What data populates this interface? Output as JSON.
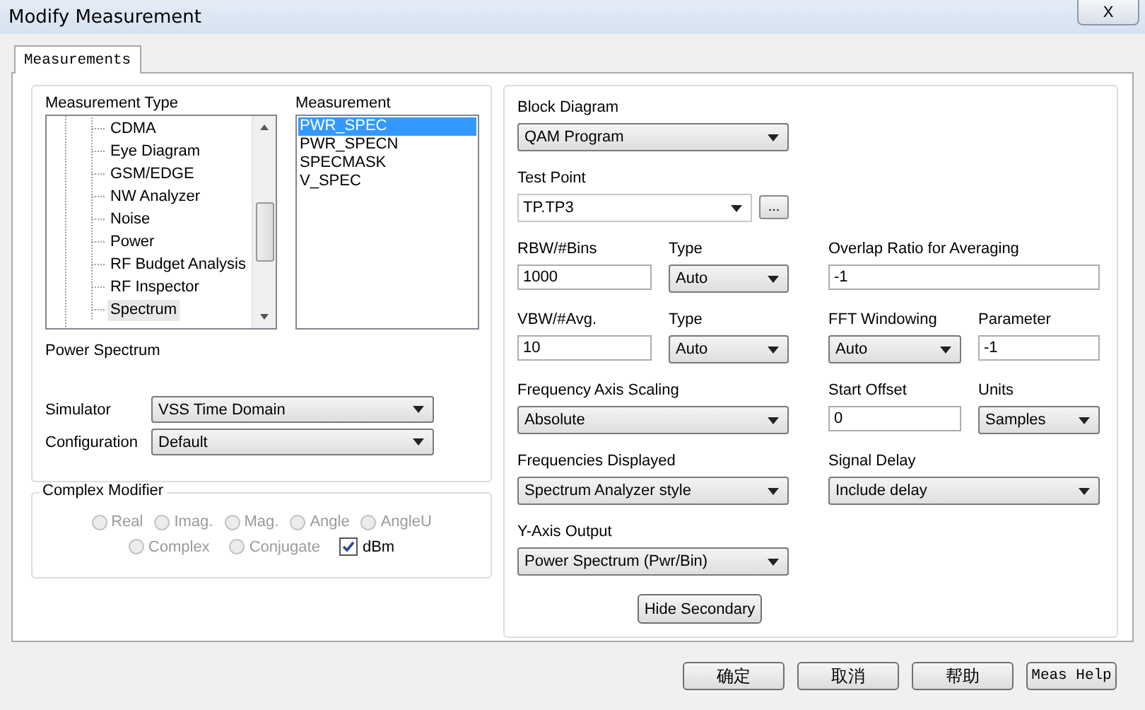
{
  "window": {
    "title": "Modify Measurement",
    "close_label": "X"
  },
  "tabs": [
    {
      "label": "Measurements",
      "selected": true
    }
  ],
  "measurement_type": {
    "label": "Measurement Type",
    "items": [
      {
        "label": "CDMA",
        "selected": false
      },
      {
        "label": "Eye Diagram",
        "selected": false
      },
      {
        "label": "GSM/EDGE",
        "selected": false
      },
      {
        "label": "NW Analyzer",
        "selected": false
      },
      {
        "label": "Noise",
        "selected": false
      },
      {
        "label": "Power",
        "selected": false
      },
      {
        "label": "RF Budget Analysis",
        "selected": false
      },
      {
        "label": "RF Inspector",
        "selected": false
      },
      {
        "label": "Spectrum",
        "selected": true
      }
    ]
  },
  "measurement": {
    "label": "Measurement",
    "items": [
      {
        "label": "PWR_SPEC",
        "selected": true
      },
      {
        "label": "PWR_SPECN",
        "selected": false
      },
      {
        "label": "SPECMASK",
        "selected": false
      },
      {
        "label": "V_SPEC",
        "selected": false
      }
    ]
  },
  "description": "Power Spectrum",
  "simulator": {
    "label": "Simulator",
    "value": "VSS Time Domain"
  },
  "configuration": {
    "label": "Configuration",
    "value": "Default"
  },
  "complex_modifier": {
    "title": "Complex Modifier",
    "options": [
      {
        "kind": "radio",
        "label": "Real",
        "selected": false,
        "disabled": true
      },
      {
        "kind": "radio",
        "label": "Imag.",
        "selected": false,
        "disabled": true
      },
      {
        "kind": "radio",
        "label": "Mag.",
        "selected": false,
        "disabled": true
      },
      {
        "kind": "radio",
        "label": "Angle",
        "selected": false,
        "disabled": true
      },
      {
        "kind": "radio",
        "label": "AngleU",
        "selected": false,
        "disabled": true
      },
      {
        "kind": "radio",
        "label": "Complex",
        "selected": false,
        "disabled": true
      },
      {
        "kind": "radio",
        "label": "Conjugate",
        "selected": false,
        "disabled": true
      },
      {
        "kind": "checkbox",
        "label": "dBm",
        "checked": true,
        "disabled": false
      }
    ]
  },
  "settings": [
    {
      "kind": "dropdown",
      "label": "Block Diagram",
      "value": "QAM Program"
    },
    {
      "kind": "combo",
      "label": "Test Point",
      "value": "TP.TP3",
      "browse": "..."
    },
    {
      "kind": "text",
      "label": "RBW/#Bins",
      "value": "1000"
    },
    {
      "kind": "dropdown",
      "label": "Type",
      "value": "Auto"
    },
    {
      "kind": "text",
      "label": "Overlap Ratio for Averaging",
      "value": "-1"
    },
    {
      "kind": "text",
      "label": "VBW/#Avg.",
      "value": "10"
    },
    {
      "kind": "dropdown",
      "label": "Type",
      "value": "Auto"
    },
    {
      "kind": "dropdown",
      "label": "FFT Windowing",
      "value": "Auto"
    },
    {
      "kind": "text",
      "label": "Parameter",
      "value": "-1"
    },
    {
      "kind": "dropdown",
      "label": "Frequency Axis Scaling",
      "value": "Absolute"
    },
    {
      "kind": "text",
      "label": "Start Offset",
      "value": "0"
    },
    {
      "kind": "dropdown",
      "label": "Units",
      "value": "Samples"
    },
    {
      "kind": "dropdown",
      "label": "Frequencies Displayed",
      "value": "Spectrum Analyzer style"
    },
    {
      "kind": "dropdown",
      "label": "Signal Delay",
      "value": "Include delay"
    },
    {
      "kind": "dropdown",
      "label": "Y-Axis Output",
      "value": "Power Spectrum (Pwr/Bin)"
    }
  ],
  "hide_secondary": "Hide Secondary",
  "buttons": [
    {
      "kind": "cjk",
      "label": "确定"
    },
    {
      "kind": "cjk",
      "label": "取消"
    },
    {
      "kind": "cjk",
      "label": "帮助"
    },
    {
      "kind": "mono",
      "label": "Meas Help"
    }
  ]
}
